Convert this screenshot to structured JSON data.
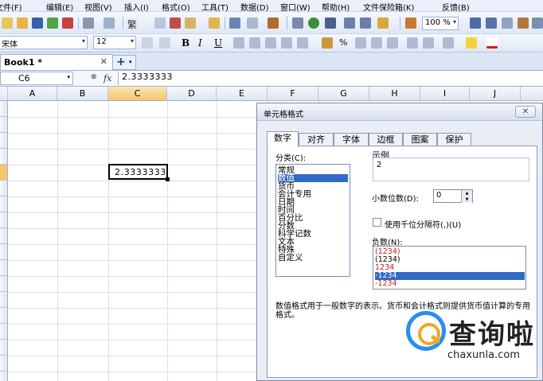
{
  "menu": [
    "文件(F)",
    "编辑(E)",
    "视图(V)",
    "插入(I)",
    "格式(O)",
    "工具(T)",
    "数据(D)",
    "窗口(W)",
    "帮助(H)",
    "文件保险箱(K)",
    "反馈(B)"
  ],
  "toolbar": {
    "zoom": "100 %",
    "traditional": "繁"
  },
  "format_toolbar": {
    "font_name": "宋体",
    "font_size": "12",
    "bold": "B",
    "italic": "I",
    "underline": "U",
    "percent": "%"
  },
  "tabs": {
    "book": "Book1 *",
    "close": "✕",
    "new": "+"
  },
  "formula_bar": {
    "cell_ref": "C6",
    "fx": "fx",
    "value": "2.3333333"
  },
  "sheet": {
    "columns": [
      "A",
      "B",
      "C",
      "D",
      "E",
      "F",
      "G",
      "H",
      "I",
      "J"
    ],
    "active_col": "C",
    "active_value": "2.3333333"
  },
  "dialog": {
    "title": "单元格格式",
    "close": "✕",
    "tabs": [
      "数字",
      "对齐",
      "字体",
      "边框",
      "图案",
      "保护"
    ],
    "category_label": "分类(C):",
    "categories": [
      "常规",
      "数值",
      "货币",
      "会计专用",
      "日期",
      "时间",
      "百分比",
      "分数",
      "科学记数",
      "文本",
      "特殊",
      "自定义"
    ],
    "selected_category": "数值",
    "sample_label": "示例",
    "sample_value": "2",
    "decimal_label": "小数位数(D):",
    "decimal_value": "0",
    "thousands_label": "使用千位分隔符(,)(U)",
    "negative_label": "负数(N):",
    "negatives": [
      {
        "text": "(1234)",
        "red": true
      },
      {
        "text": "(1234)",
        "red": false
      },
      {
        "text": "1234",
        "red": true
      },
      {
        "text": "-1234",
        "red": false,
        "selected": true
      },
      {
        "text": "-1234",
        "red": true
      }
    ],
    "description": "数值格式用于一般数字的表示。货币和会计格式则提供货币值计算的专用格式。"
  },
  "watermark": {
    "text": "查询啦",
    "url": "chaxunla.com"
  },
  "colors": {
    "selection": "#316ac5",
    "header_selected": "#f5c76b",
    "negative_red": "#d01c1c",
    "watermark_blue": "#2a8df0",
    "watermark_orange": "#f5a623"
  }
}
